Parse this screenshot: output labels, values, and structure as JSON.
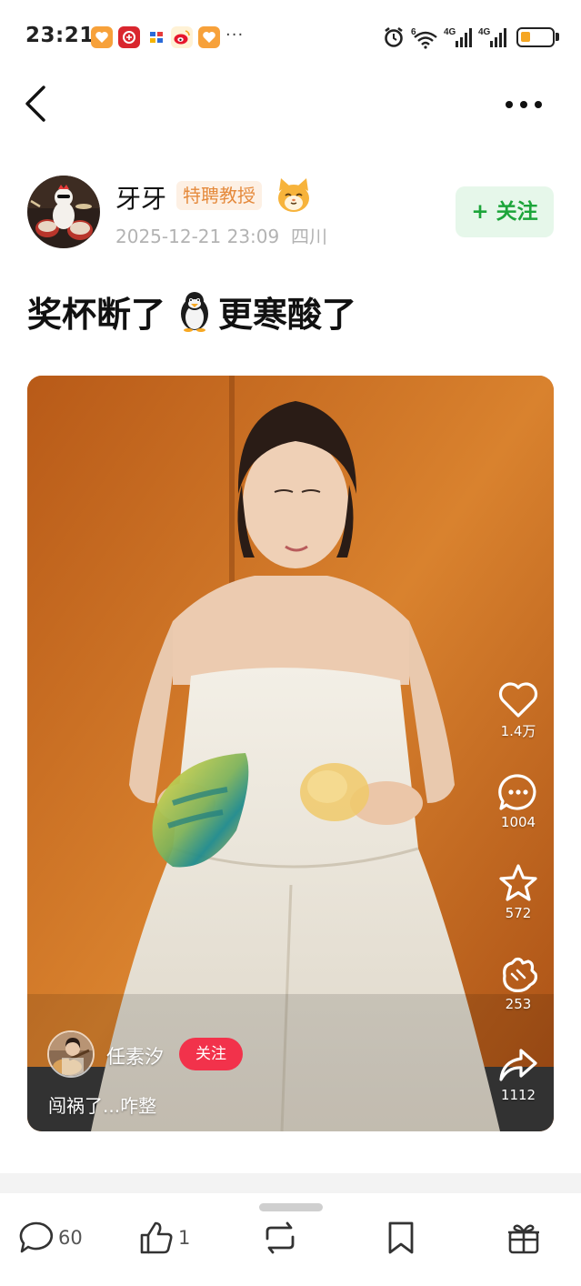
{
  "status_bar": {
    "time": "23:21",
    "app_icons": [
      "taobao-heart-icon",
      "red-app-icon",
      "blue-app-icon",
      "weibo-icon",
      "taobao-heart-icon"
    ],
    "more": "···",
    "network_labels": [
      "6",
      "4G",
      "4G"
    ]
  },
  "post": {
    "author": {
      "name": "牙牙",
      "badge": "特聘教授",
      "meta": "2025-12-21 23:09  四川"
    },
    "follow_label": "+ 关注",
    "title_part1": "奖杯断了",
    "title_part2": "更寒酸了",
    "title_emoji": "penguin-emoji"
  },
  "video": {
    "user_name": "任素汐",
    "follow_label": "关注",
    "caption": "闯祸了...咋整",
    "actions": [
      {
        "icon": "heart-icon",
        "count": "1.4万"
      },
      {
        "icon": "comment-icon",
        "count": "1004"
      },
      {
        "icon": "star-icon",
        "count": "572"
      },
      {
        "icon": "clap-icon",
        "count": "253"
      },
      {
        "icon": "share-icon",
        "count": "1112"
      }
    ]
  },
  "toolbar": {
    "comment_count": "60",
    "like_count": "1"
  },
  "colors": {
    "accent_green": "#1ca53a",
    "follow_bg": "#e6f7ea",
    "badge_orange": "#e58a3c",
    "video_follow_red": "#f2324b"
  }
}
